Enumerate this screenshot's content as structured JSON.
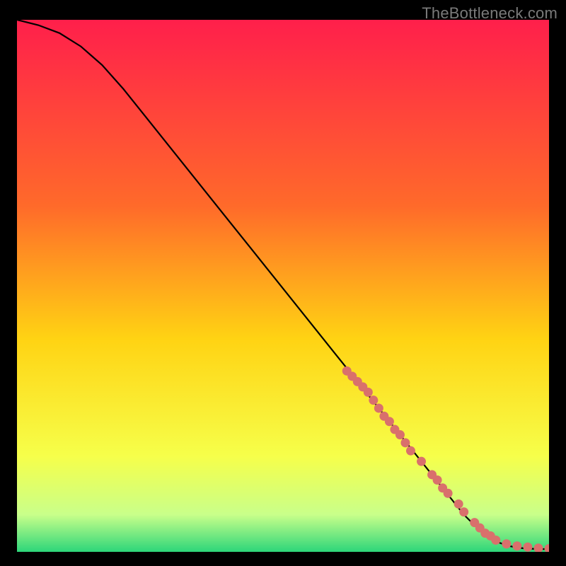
{
  "watermark": "TheBottleneck.com",
  "chart_data": {
    "type": "line",
    "title": "",
    "xlabel": "",
    "ylabel": "",
    "xlim": [
      0,
      100
    ],
    "ylim": [
      0,
      100
    ],
    "grid": false,
    "legend": false,
    "series": [
      {
        "name": "curve",
        "style": "line",
        "color": "#000000",
        "x": [
          0,
          4,
          8,
          12,
          16,
          20,
          24,
          28,
          32,
          36,
          40,
          44,
          48,
          52,
          56,
          60,
          64,
          68,
          72,
          76,
          80,
          82,
          84,
          86,
          88,
          90,
          92,
          94,
          96,
          98,
          100
        ],
        "y": [
          100,
          99,
          97.5,
          95,
          91.5,
          87,
          82,
          77,
          72,
          67,
          62,
          57,
          52,
          47,
          42,
          37,
          32,
          27,
          22,
          17,
          12,
          9.5,
          7,
          5,
          3.3,
          2,
          1.2,
          0.8,
          0.6,
          0.55,
          0.5
        ]
      },
      {
        "name": "points-cluster",
        "style": "scatter",
        "color": "#d9706c",
        "x": [
          62,
          63,
          64,
          65,
          66,
          67,
          68,
          69,
          70,
          71,
          72,
          73,
          74,
          76,
          78,
          79,
          80,
          81,
          83,
          84,
          86,
          87,
          88,
          89,
          90,
          92,
          94,
          96,
          98,
          100
        ],
        "y": [
          34,
          33,
          32,
          31,
          30,
          28.5,
          27,
          25.5,
          24.5,
          23,
          22,
          20.5,
          19,
          17,
          14.5,
          13.5,
          12,
          11,
          9,
          7.5,
          5.5,
          4.5,
          3.5,
          3,
          2.2,
          1.5,
          1.1,
          0.9,
          0.7,
          0.6
        ]
      }
    ],
    "background_gradient": {
      "top": "#ff1f4b",
      "mid1": "#ff6a2a",
      "mid2": "#ffd313",
      "mid3": "#f6ff4a",
      "mid4": "#c9ff8a",
      "bottom": "#2dd67a"
    }
  }
}
